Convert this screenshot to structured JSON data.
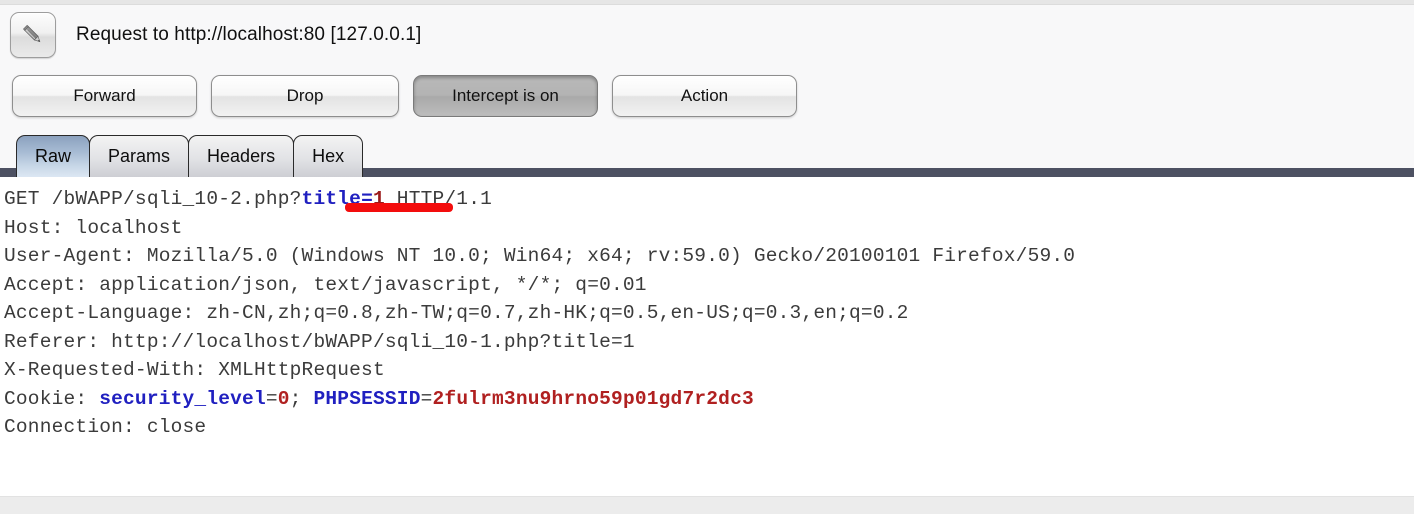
{
  "window": {
    "icon": "pencil-icon",
    "title": "Request to http://localhost:80  [127.0.0.1]"
  },
  "toolbar": {
    "buttons": [
      {
        "label": "Forward",
        "name": "forward-button",
        "pressed": false
      },
      {
        "label": "Drop",
        "name": "drop-button",
        "pressed": false
      },
      {
        "label": "Intercept is on",
        "name": "intercept-toggle-button",
        "pressed": true
      },
      {
        "label": "Action",
        "name": "action-button",
        "pressed": false
      }
    ]
  },
  "tabs": {
    "selected": "Raw",
    "items": [
      {
        "label": "Raw"
      },
      {
        "label": "Params"
      },
      {
        "label": "Headers"
      },
      {
        "label": "Hex"
      }
    ]
  },
  "request": {
    "lines": {
      "request_line_pre": "GET /bWAPP/sqli_10-2.php?",
      "request_line_param": "title=",
      "request_line_value": "1",
      "request_line_post": " HTTP/1.1",
      "host": "Host: localhost",
      "user_agent": "User-Agent: Mozilla/5.0 (Windows NT 10.0; Win64; x64; rv:59.0) Gecko/20100101 Firefox/59.0",
      "accept": "Accept: application/json, text/javascript, */*; q=0.01",
      "accept_language": "Accept-Language: zh-CN,zh;q=0.8,zh-TW;q=0.7,zh-HK;q=0.5,en-US;q=0.3,en;q=0.2",
      "referer": "Referer: http://localhost/bWAPP/sqli_10-1.php?title=1",
      "x_requested_with": "X-Requested-With: XMLHttpRequest",
      "cookie_label": "Cookie: ",
      "cookie_name_1": "security_level",
      "cookie_eq_1": "=",
      "cookie_value_1": "0",
      "cookie_sep": "; ",
      "cookie_name_2": "PHPSESSID",
      "cookie_eq_2": "=",
      "cookie_value_2": "2fulrm3nu9hrno59p01gd7r2dc3",
      "connection": "Connection: close"
    },
    "annotation": {
      "type": "red-underline",
      "target": "title=1"
    }
  },
  "colors": {
    "annotation_red": "#f30d0d",
    "keyword_blue": "#2020c0",
    "value_red": "#9b1b1b",
    "tab_selected_blue": "#a8bcd4",
    "tabstrip_bar": "#4d5162",
    "panel_bg": "#f8f8f9",
    "footer_bg": "#ececec"
  }
}
